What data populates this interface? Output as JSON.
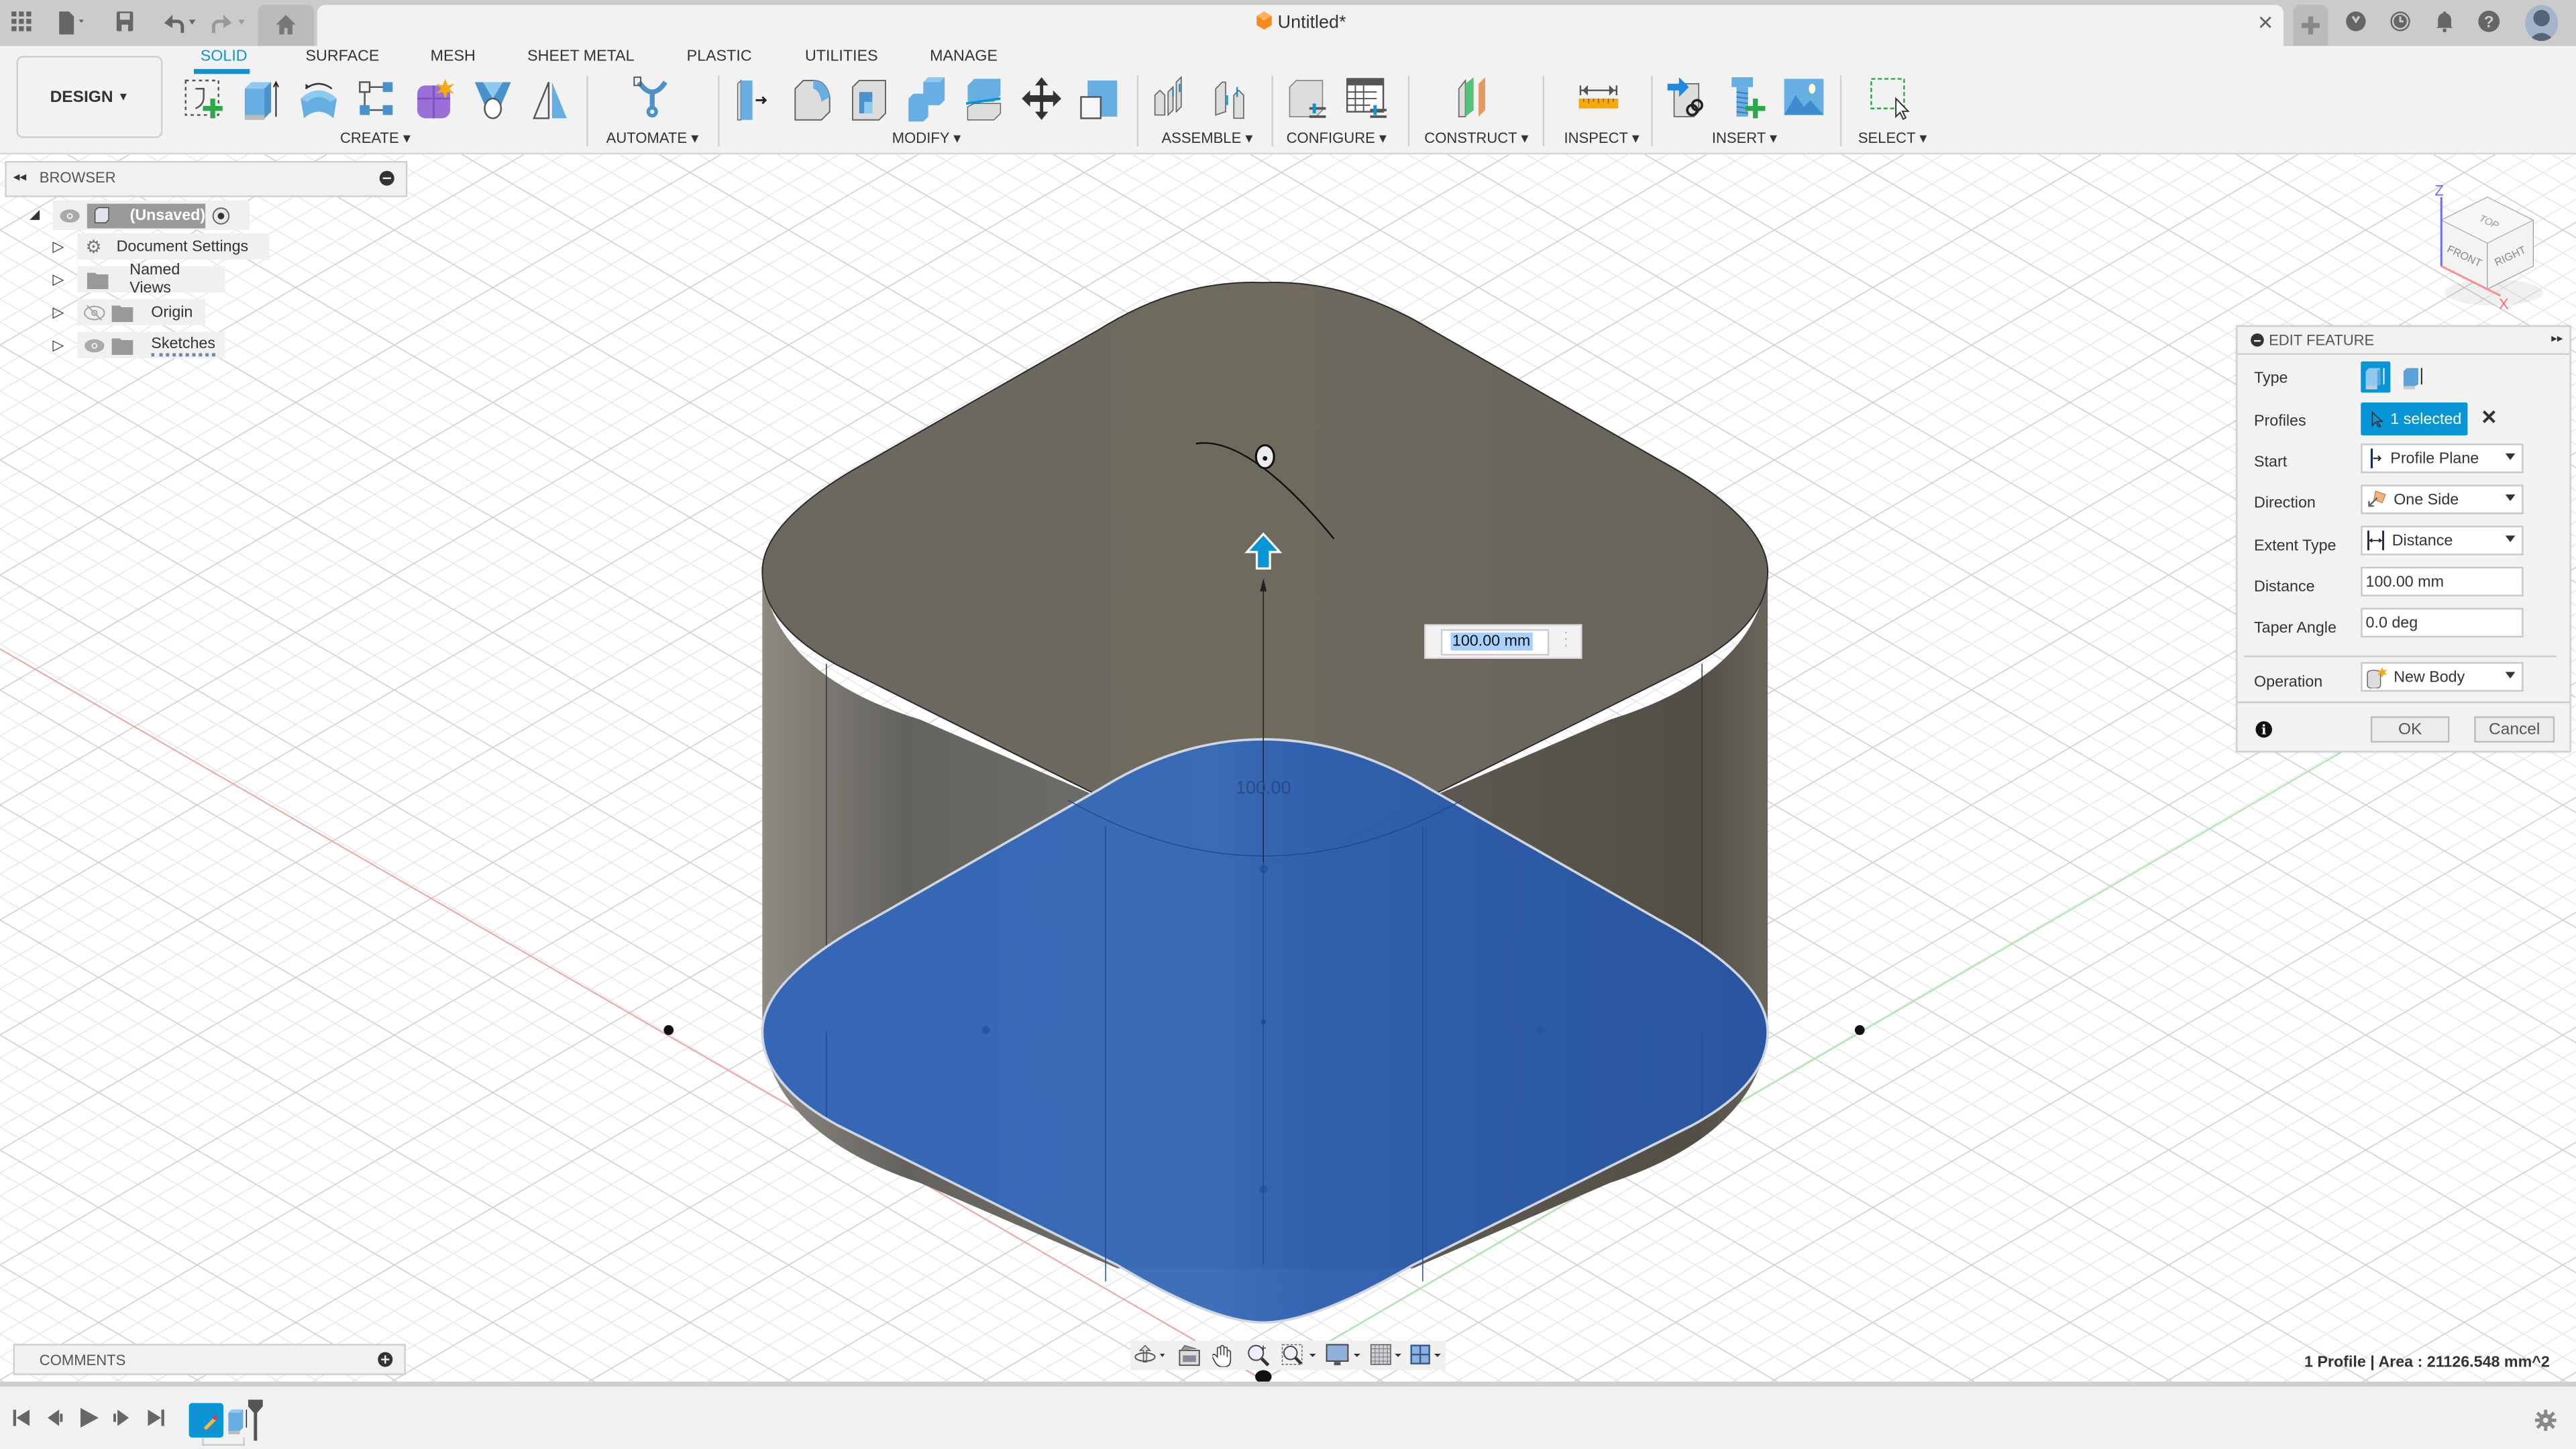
{
  "titlebar": {
    "document_title": "Untitled*",
    "icons": [
      "apps-grid-icon",
      "file-icon",
      "save-icon",
      "undo-icon",
      "redo-icon",
      "home-icon",
      "close-icon",
      "new-tab-icon",
      "extensions-icon",
      "job-status-icon",
      "notifications-icon",
      "help-icon",
      "user-avatar"
    ]
  },
  "toolbar": {
    "workspace": "DESIGN",
    "tabs": [
      {
        "label": "SOLID",
        "active": true
      },
      {
        "label": "SURFACE"
      },
      {
        "label": "MESH"
      },
      {
        "label": "SHEET METAL"
      },
      {
        "label": "PLASTIC"
      },
      {
        "label": "UTILITIES"
      },
      {
        "label": "MANAGE"
      }
    ],
    "groups": [
      {
        "label": "CREATE",
        "tools": [
          "create-sketch",
          "extrude",
          "revolve",
          "pattern",
          "create-form",
          "hole",
          "mirror"
        ]
      },
      {
        "label": "AUTOMATE",
        "tools": [
          "automated-modeling"
        ]
      },
      {
        "label": "MODIFY",
        "tools": [
          "press-pull",
          "fillet",
          "shell",
          "combine",
          "split-body",
          "move-copy",
          "scale"
        ]
      },
      {
        "label": "ASSEMBLE",
        "tools": [
          "joint",
          "as-built-joint"
        ]
      },
      {
        "label": "CONFIGURE",
        "tools": [
          "configure-model",
          "configuration-table"
        ]
      },
      {
        "label": "CONSTRUCT",
        "tools": [
          "offset-plane"
        ]
      },
      {
        "label": "INSPECT",
        "tools": [
          "measure"
        ]
      },
      {
        "label": "INSERT",
        "tools": [
          "insert-derive",
          "insert-mcmaster",
          "insert-canvas"
        ]
      },
      {
        "label": "SELECT",
        "tools": [
          "select"
        ]
      }
    ]
  },
  "browser": {
    "title": "BROWSER",
    "root": "(Unsaved)",
    "items": [
      {
        "label": "Document Settings",
        "icon": "gear-icon"
      },
      {
        "label": "Named Views",
        "icon": "folder-icon"
      },
      {
        "label": "Origin",
        "icon": "folder-icon",
        "visibility": "hidden"
      },
      {
        "label": "Sketches",
        "icon": "folder-icon",
        "visibility": "visible"
      }
    ]
  },
  "viewcube": {
    "faces": {
      "top": "TOP",
      "front": "FRONT",
      "right": "RIGHT"
    },
    "axes": {
      "z": "Z",
      "x": "X"
    }
  },
  "edit_feature": {
    "title": "EDIT FEATURE",
    "rows": {
      "type_label": "Type",
      "profiles_label": "Profiles",
      "profiles_value": "1 selected",
      "start_label": "Start",
      "start_value": "Profile Plane",
      "direction_label": "Direction",
      "direction_value": "One Side",
      "extent_label": "Extent Type",
      "extent_value": "Distance",
      "distance_label": "Distance",
      "distance_value": "100.00 mm",
      "taper_label": "Taper Angle",
      "taper_value": "0.0 deg",
      "operation_label": "Operation",
      "operation_value": "New Body"
    },
    "ok_label": "OK",
    "cancel_label": "Cancel"
  },
  "canvas": {
    "distance_input": "100.00 mm",
    "dimension_label": "100.00",
    "colors": {
      "body": "#6e6a60",
      "profile": "#3366b8"
    }
  },
  "comments": {
    "title": "COMMENTS"
  },
  "status": {
    "text": "1 Profile | Area : 21126.548 mm^2"
  },
  "timeline": {
    "controls": [
      "first",
      "previous",
      "play",
      "next",
      "last"
    ],
    "items": [
      "sketch",
      "extrude"
    ]
  },
  "colors": {
    "accent": "#0696d7",
    "toolbar_bg": "#f2f2f2",
    "titlebar_bg": "#cbcbcb"
  }
}
